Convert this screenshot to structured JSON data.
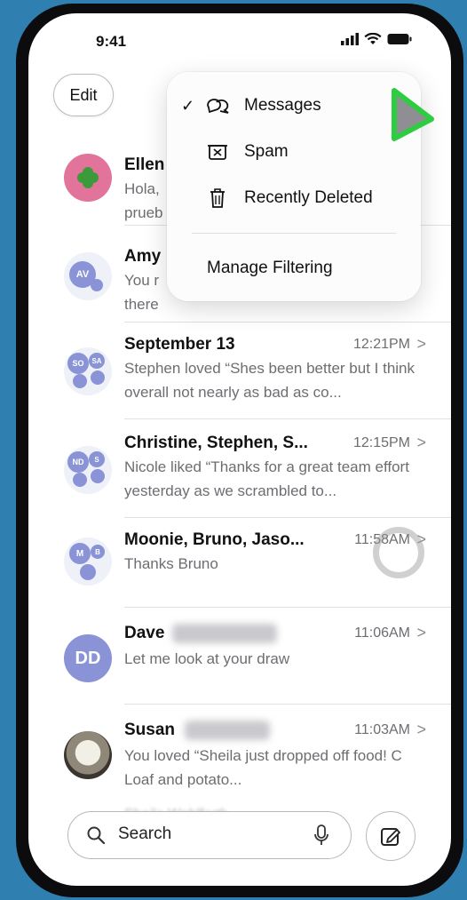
{
  "status_bar": {
    "time": "9:41"
  },
  "header": {
    "edit_label": "Edit"
  },
  "filter_menu": {
    "items": [
      {
        "label": "Messages",
        "icon": "bubbles-icon",
        "checked": true
      },
      {
        "label": "Spam",
        "icon": "spam-box-icon",
        "checked": false
      },
      {
        "label": "Recently Deleted",
        "icon": "trash-icon",
        "checked": false
      }
    ],
    "manage_label": "Manage Filtering",
    "check_glyph": "✓"
  },
  "conversations": [
    {
      "name": "Ellen",
      "time": "",
      "preview": "Hola, prueb",
      "avatar": "clover"
    },
    {
      "name": "Amy",
      "time": "",
      "preview": "You r there",
      "avatar_initials": "AV"
    },
    {
      "name": "September 13",
      "time": "12:21PM",
      "preview": "Stephen loved “Shes been better but I think overall not nearly as bad as co...",
      "avatar_initials": [
        "SO",
        "SA"
      ]
    },
    {
      "name": "Christine, Stephen, S...",
      "time": "12:15PM",
      "preview": "Nicole liked “Thanks for a great team effort yesterday as we scrambled to...",
      "avatar_initials": [
        "ND",
        "S"
      ]
    },
    {
      "name": "Moonie, Bruno, Jaso...",
      "time": "11:58AM",
      "preview": "Thanks Bruno",
      "avatar_initials": [
        "M",
        "B"
      ]
    },
    {
      "name": "Dave",
      "time": "11:06AM",
      "preview": "Let me look at your draw",
      "avatar_initials": "DD"
    },
    {
      "name": "Susan",
      "time": "11:03AM",
      "preview": "You loved “Sheila just dropped off food! C Loaf and potato...",
      "avatar": "cat-photo"
    },
    {
      "name": "Sheila Wohlfarth",
      "time": ""
    }
  ],
  "chevron": ">",
  "bottom_bar": {
    "search_placeholder": "Search"
  },
  "colors": {
    "cursor": "#2ecc40",
    "avatar_blue": "#8a93d6",
    "clover_bg": "#e2739a"
  }
}
